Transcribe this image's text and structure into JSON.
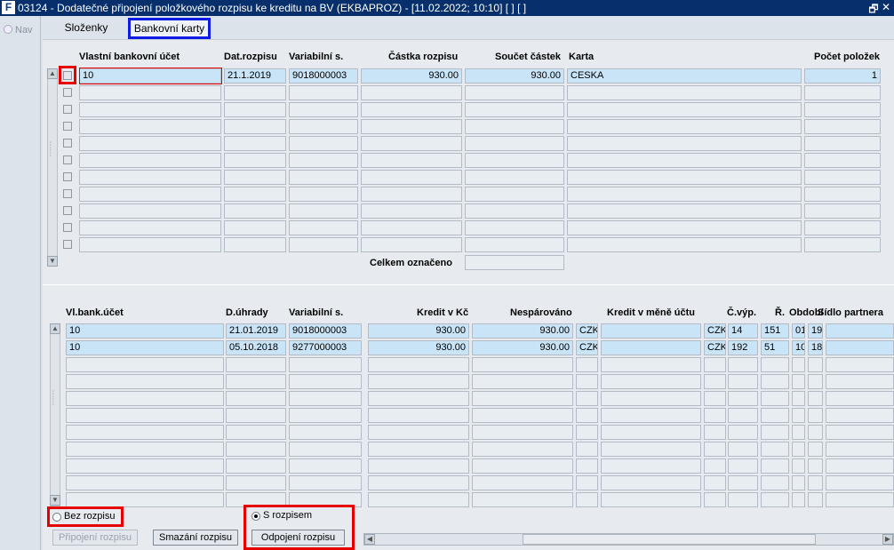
{
  "window": {
    "title": "03124 - Dodatečné připojení položkového rozpisu ke kreditu na BV (EKBAPROZ) - [11.02.2022; 10:10]  [ ]  [ ]",
    "logo": "F",
    "restore_glyph": "🗗",
    "close_glyph": "✕"
  },
  "nav": {
    "label": "Nav"
  },
  "tabs": [
    {
      "label": "Složenky"
    },
    {
      "label": "Bankovní karty"
    }
  ],
  "table1": {
    "headers": [
      "Vlastní bankovní účet",
      "Dat.rozpisu",
      "Variabilní s.",
      "Částka rozpisu",
      "Součet částek",
      "Karta",
      "Počet položek"
    ],
    "rows": [
      [
        "10",
        "21.1.2019",
        "9018000003",
        "930.00",
        "930.00",
        "CESKA",
        "1"
      ]
    ],
    "total_label": "Celkem označeno",
    "total_value": ""
  },
  "table2": {
    "headers": [
      "Vl.bank.účet",
      "D.úhrady",
      "Variabilní s.",
      "Kredit v Kč",
      "Nespárováno",
      "Kredit v měně účtu",
      "Č.výp.",
      "Ř.",
      "Období",
      "Sídlo partnera"
    ],
    "rows": [
      [
        "10",
        "21.01.2019",
        "9018000003",
        "930.00",
        "930.00",
        "CZK",
        "",
        "CZK",
        "14",
        "151",
        "01",
        "19"
      ],
      [
        "10",
        "05.10.2018",
        "9277000003",
        "930.00",
        "930.00",
        "CZK",
        "",
        "CZK",
        "192",
        "51",
        "10",
        "18"
      ]
    ]
  },
  "footer": {
    "radio_bez": "Bez rozpisu",
    "radio_s": "S rozpisem",
    "radio_selected": "S rozpisem",
    "btn_pripojeni": "Připojení rozpisu",
    "btn_smazani": "Smazání rozpisu",
    "btn_odpojeni": "Odpojení rozpisu"
  },
  "highlight_colors": {
    "red": "#e60000",
    "blue": "#0d1be6"
  }
}
